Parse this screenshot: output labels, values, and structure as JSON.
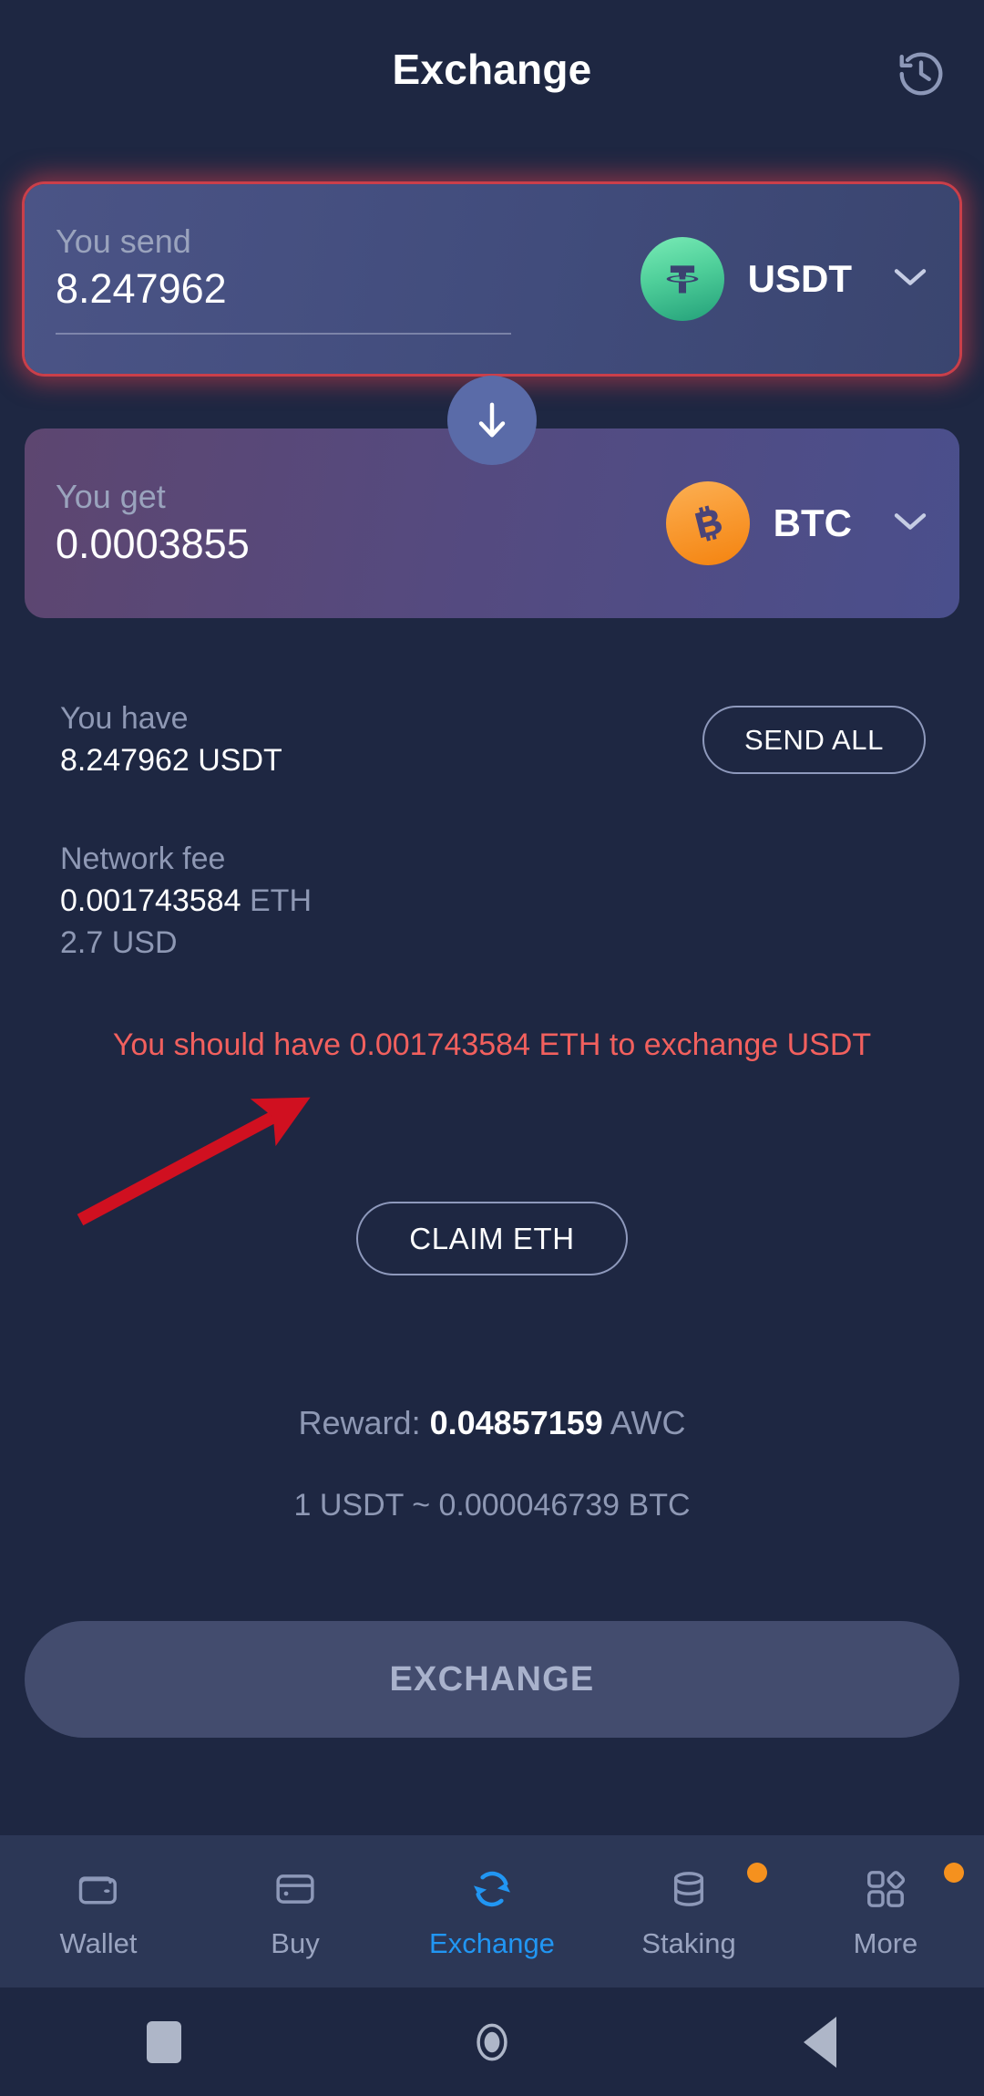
{
  "header": {
    "title": "Exchange",
    "history_icon": "history-clock-icon"
  },
  "send_card": {
    "label": "You send",
    "amount": "8.247962",
    "coin": "USDT",
    "coin_logo": "tether-logo-icon",
    "chevron": "chevron-down-icon"
  },
  "swap": {
    "icon": "arrow-down-icon"
  },
  "get_card": {
    "label": "You get",
    "amount": "0.0003855",
    "coin": "BTC",
    "coin_logo": "bitcoin-logo-icon",
    "chevron": "chevron-down-icon"
  },
  "balance": {
    "label": "You have",
    "value": "8.247962 USDT",
    "send_all_label": "SEND ALL"
  },
  "network_fee": {
    "label": "Network fee",
    "amount": "0.001743584",
    "unit": "ETH",
    "fiat": "2.7 USD"
  },
  "error": {
    "message": "You should have 0.001743584 ETH to exchange USDT",
    "color": "#f2605e"
  },
  "claim": {
    "label": "CLAIM ETH"
  },
  "reward": {
    "label": "Reward:",
    "value": "0.04857159",
    "unit": "AWC"
  },
  "rate": {
    "text": "1 USDT ~ 0.000046739 BTC"
  },
  "exchange_button": {
    "label": "EXCHANGE",
    "disabled": true
  },
  "annotation": {
    "type": "red-arrow",
    "color": "#d01020"
  },
  "bottom_nav": {
    "active_color": "#2196f3",
    "badge_color": "#f5911e",
    "items": [
      {
        "label": "Wallet",
        "icon": "wallet-icon",
        "active": false,
        "badge": false
      },
      {
        "label": "Buy",
        "icon": "card-icon",
        "active": false,
        "badge": false
      },
      {
        "label": "Exchange",
        "icon": "refresh-icon",
        "active": true,
        "badge": false
      },
      {
        "label": "Staking",
        "icon": "database-icon",
        "active": false,
        "badge": true
      },
      {
        "label": "More",
        "icon": "grid-icon",
        "active": false,
        "badge": true
      }
    ]
  },
  "system_bar": {
    "recents_icon": "square-icon",
    "home_icon": "circle-icon",
    "back_icon": "triangle-back-icon"
  }
}
